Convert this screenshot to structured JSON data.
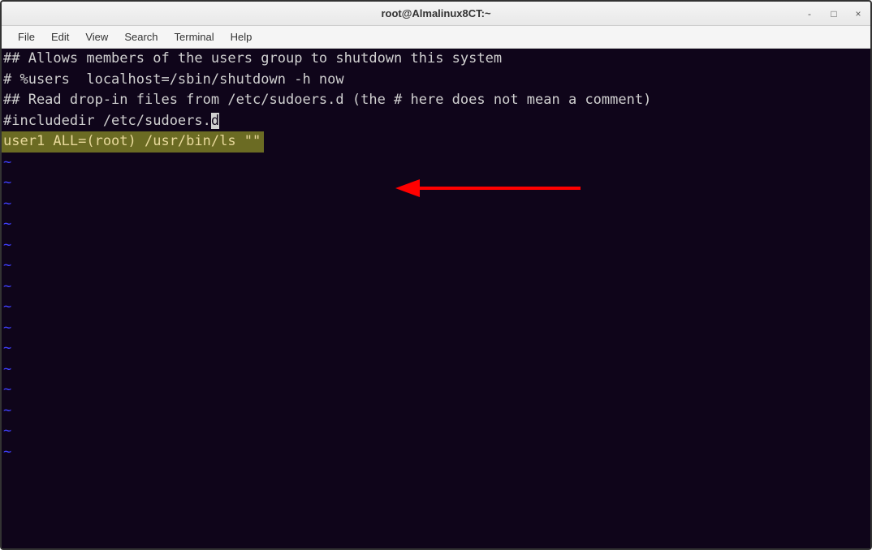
{
  "window": {
    "title": "root@Almalinux8CT:~",
    "controls": {
      "minimize": "-",
      "maximize": "□",
      "close": "×"
    }
  },
  "menubar": {
    "file": "File",
    "edit": "Edit",
    "view": "View",
    "search": "Search",
    "terminal": "Terminal",
    "help": "Help"
  },
  "terminal": {
    "line1": "## Allows members of the users group to shutdown this system",
    "line2": "# %users  localhost=/sbin/shutdown -h now",
    "line3": "",
    "line4": "## Read drop-in files from /etc/sudoers.d (the # here does not mean a comment)",
    "line5a": "#includedir /etc/sudoers.",
    "line5b": "d",
    "line6": "",
    "line7": "user1   ALL=(root)      /usr/bin/ls \"\"",
    "tilde": "~"
  },
  "annotation": {
    "color": "#ff0000"
  }
}
